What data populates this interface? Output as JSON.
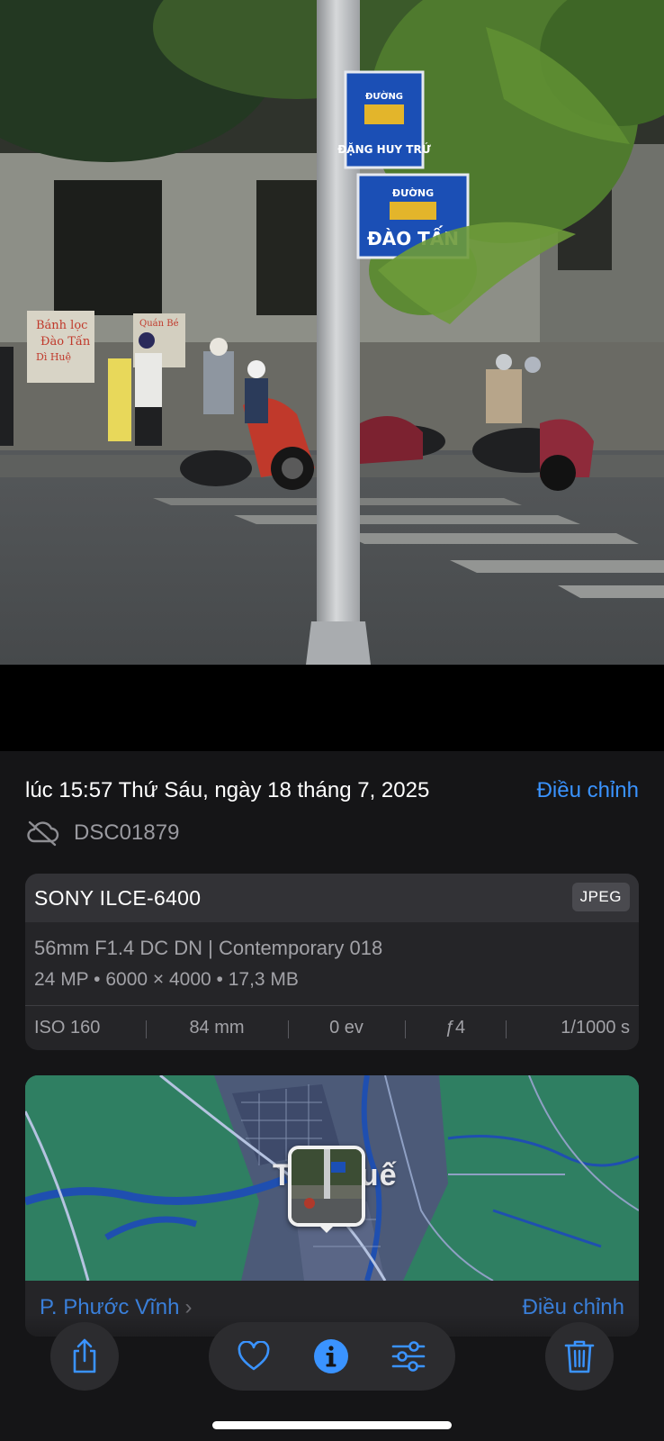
{
  "photo": {
    "sign_top": {
      "line1": "ĐƯỜNG",
      "line2": "ĐẶNG HUY TRỨ"
    },
    "sign_bottom": {
      "line1": "ĐƯỜNG",
      "line2": "ĐÀO TẤN"
    },
    "shop_sign_left": {
      "line1": "Bánh lọc",
      "line2": "Đào Tấn",
      "line3": "Dì Huệ"
    },
    "shop_sign_right": {
      "line1": "Quán Bé"
    }
  },
  "info": {
    "date_time": "lúc 15:57 Thứ Sáu, ngày 18 tháng 7, 2025",
    "adjust_label": "Điều chỉnh",
    "file_name": "DSC01879"
  },
  "camera": {
    "model": "SONY ILCE-6400",
    "format": "JPEG",
    "lens": "56mm F1.4 DC DN | Contemporary 018",
    "specs": "24 MP • 6000 × 4000 • 17,3 MB",
    "exif": {
      "iso": "ISO 160",
      "focal": "84 mm",
      "ev": "0 ev",
      "aperture": "ƒ4",
      "shutter": "1/1000 s"
    }
  },
  "map": {
    "city": "Tuy Huế",
    "place": "P. Phước Vĩnh",
    "adjust_label": "Điều chỉnh"
  },
  "icons": {
    "cloud": "cloud-off-icon",
    "share": "share-icon",
    "favorite": "heart-icon",
    "info": "info-icon",
    "edit": "sliders-icon",
    "delete": "trash-icon"
  },
  "colors": {
    "accent": "#3a93ff",
    "sheet_bg": "#151517",
    "card_bg": "#252528"
  }
}
